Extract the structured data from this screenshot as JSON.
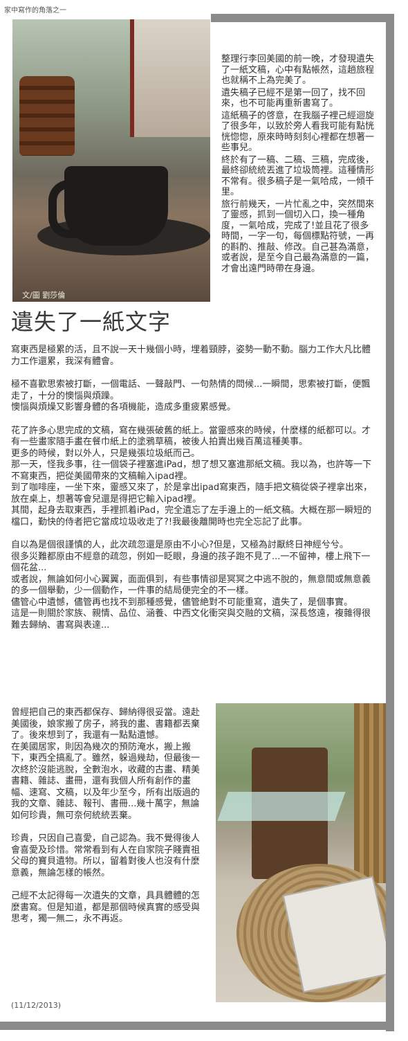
{
  "series": "家中寫作的角落之一",
  "photo_credit": "文/圖 劉莎倫",
  "title": "遺失了一紙文字",
  "right_column": [
    "整理行李回美國的前一晚，才發現遺失了一紙文稿，心中有點帳然，這趟旅程也就稱不上為完美了。",
    "遺失稿子已經不是第一回了，找不回來，也不可能再重新書寫了。",
    "這紙稿子的啓意，在我腦子裡己經迴旋了很多年，以致於旁人看我可能有點恍恍惚惚，原來時時刻刻心裡都在想著一些事兒。",
    "終於有了一稿、二稿、三稿，完成後，最終卻統統丟進了垃圾筒裡。這種情形不常有。很多稿子是一氣哈成，一傾千里。",
    "旅行前幾天，一片忙亂之中，突然間來了靈感，抓到一個切入口，換一種角度，一氣哈成，完成了!並且花了很多時間，一字一句，每個標點符號，一再的斟酌、推敲、修改。自己甚為滿意，或者說，是至今自己最為滿意的一篇，才會出遠門時帶在身邊。"
  ],
  "main_paragraphs": [
    "寫東西是極累的活，且不說一天十幾個小時，埋着頸脖，姿勢一動不動。腦力工作大凡比體力工作還累，我深有體會。",
    "",
    "極不喜歡思索被打斷，一個電話、一聲敲門、一句熱情的問候...一瞬間，思索被打斷，便飄走了，十分的懊惱與煩躁。",
    "懊惱與煩燥又影響身體的各項機能，造成多重疲累感覺。",
    "",
    "花了許多心思完成的文稿，寫在幾張破舊的紙上。當靈感來的時候，什麼樣的紙都可以。才有一些畫家隨手畫在餐巾紙上的塗鴉草稿，被後人拍賣出幾百萬這種美事。",
    "更多的時候，對以外人，只是幾張垃圾紙而己。",
    "那一天，怪我多事，往一個袋子裡塞進iPad，想了想又塞進那紙文稿。我以為，也許等一下不寫東西，把從美國帶來的文稿輸入ipad裡。",
    "到了咖啡座，一坐下來，靈感又來了，於是拿出ipad寫東西，隨手把文稿從袋子裡拿出來，放在桌上，想著等會兒還是得把它輸入ipad裡。",
    "其間，起身去取東西，手裡抓着iPad，完全遺忘了左手邊上的一紙文稿。大概在那一瞬短的檔口，勤快的侍者把它當成垃圾收走了?!我最後離開時也完全忘記了此事。",
    "",
    "自以為是個很謹慎的人，此次疏忽還是原由不小心?但是，又極為討厭終日神經兮兮。",
    "很多災難都原由不經意的疏忽，例如一眨眼，身邊的孩子跑不見了...一不留神，樓上飛下一個花盆...",
    "或者說，無論如何小心翼翼，面面俱到，有些事情卻是冥冥之中逃不脫的，無意間或無意義的多一個舉動，少一個動作，一件事的結局便完全的不一樣。",
    "儘管心中遺憾，儘管再也找不到那種感覺，儘管絶對不可能重寫，遺失了，是個事實。",
    "這是一則關於家族、親情、品位、涵養、中西文化衝突與交融的文稿，深長悠遠，複雜得很難去歸納、書寫與表達..."
  ],
  "left_column_2": [
    "曾經把自己的東西都保存、歸納得很妥當。遠赴美國後，娘家搬了房子，將我的畫、書籍都丟棄了。後來想到了，我還有一點點遺憾。",
    "在美國居家，則因為幾次的預防淹水，搬上搬下，東西全搞亂了。雖然，躲過幾劫，但最後一次終於沒能逃脫，全數泡水，收藏的古畫、精美書籍、雜誌、畫冊，還有我個人所有創作的畫幅、速寫、文稿，以及年少至今，所有出版過的我的文章、雜誌、報刊、書冊...幾十萬字，無論如何珍貴，無可奈何統統丟棄。",
    "",
    "珍貴，只因自己喜愛，自己認為。我不覺得後人會喜愛及珍惜。常常看到有人在自家院子賤賣祖父母的寶貝遺物。所以，留着對後人也沒有什麼意義，無論怎樣的帳然。",
    "",
    "己經不太記得每一次遺失的文章，具具體體的怎麼書寫。但是知道，都是那個時候真實的感受與思考，獨一無二，永不再返。"
  ],
  "date": "(11/12/2013)"
}
